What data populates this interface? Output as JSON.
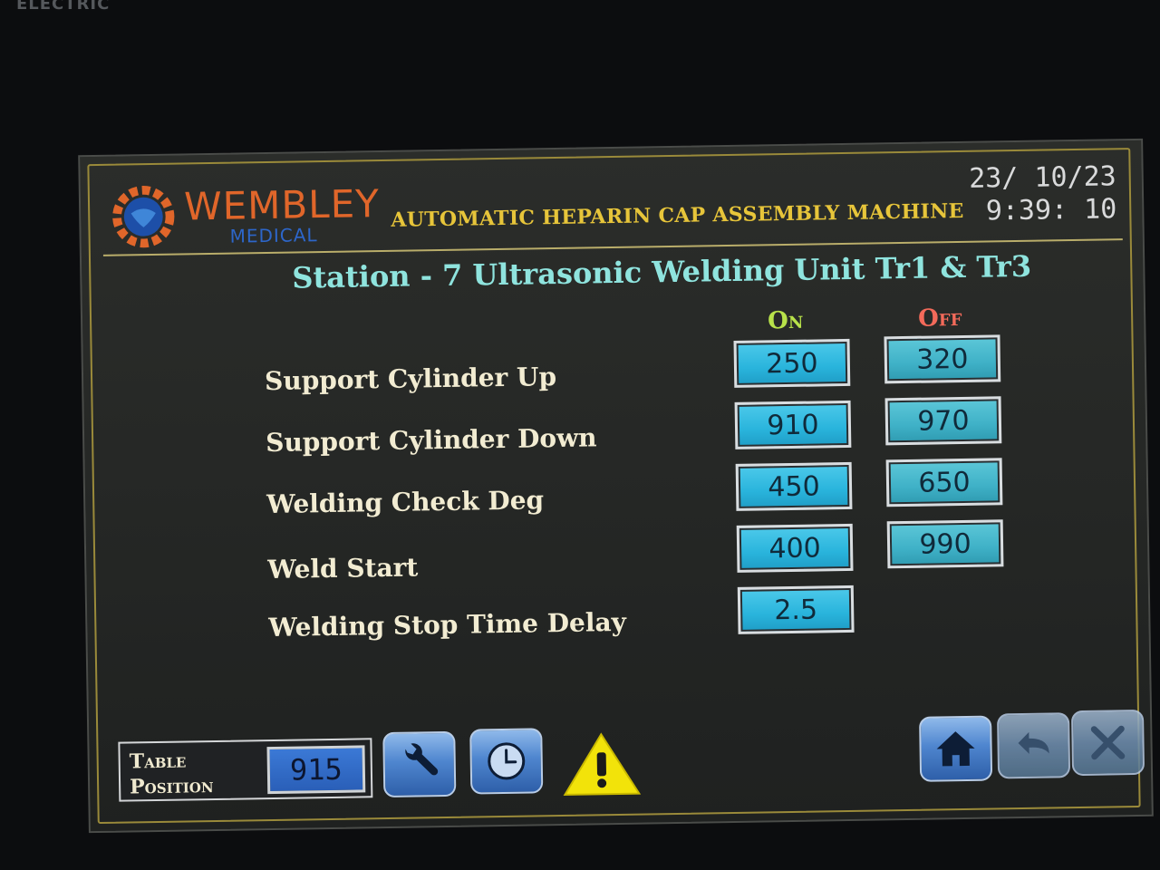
{
  "bezel": {
    "brand": "ELECTRIC"
  },
  "header": {
    "logo_text": "WEMBLEY",
    "logo_sub": "MEDICAL",
    "machine_title": "AUTOMATIC HEPARIN CAP ASSEMBLY MACHINE",
    "date": "23/ 10/23",
    "time": "9:39: 10"
  },
  "station": {
    "title": "Station - 7 Ultrasonic Welding Unit Tr1 & Tr3"
  },
  "columns": {
    "on": "On",
    "off": "Off"
  },
  "rows": [
    {
      "label": "Support Cylinder Up",
      "on": "250",
      "off": "320"
    },
    {
      "label": "Support Cylinder Down",
      "on": "910",
      "off": "970"
    },
    {
      "label": "Welding Check Deg",
      "on": "450",
      "off": "650"
    },
    {
      "label": "Weld Start",
      "on": "400",
      "off": "990"
    },
    {
      "label": "Welding Stop Time Delay",
      "on": "2.5"
    }
  ],
  "footer": {
    "table_position_label": "Table\nPosition",
    "table_position_value": "915",
    "icons": [
      "wrench-icon",
      "clock-icon",
      "warning-icon",
      "home-icon",
      "back-icon",
      "close-icon"
    ]
  },
  "colors": {
    "title_yellow": "#e7c53a",
    "station_cyan": "#8fe4de",
    "on_green": "#b8e24a",
    "off_red": "#f36a5a",
    "value_box_blue": "#29b4dc",
    "button_blue": "#4f86cf"
  }
}
